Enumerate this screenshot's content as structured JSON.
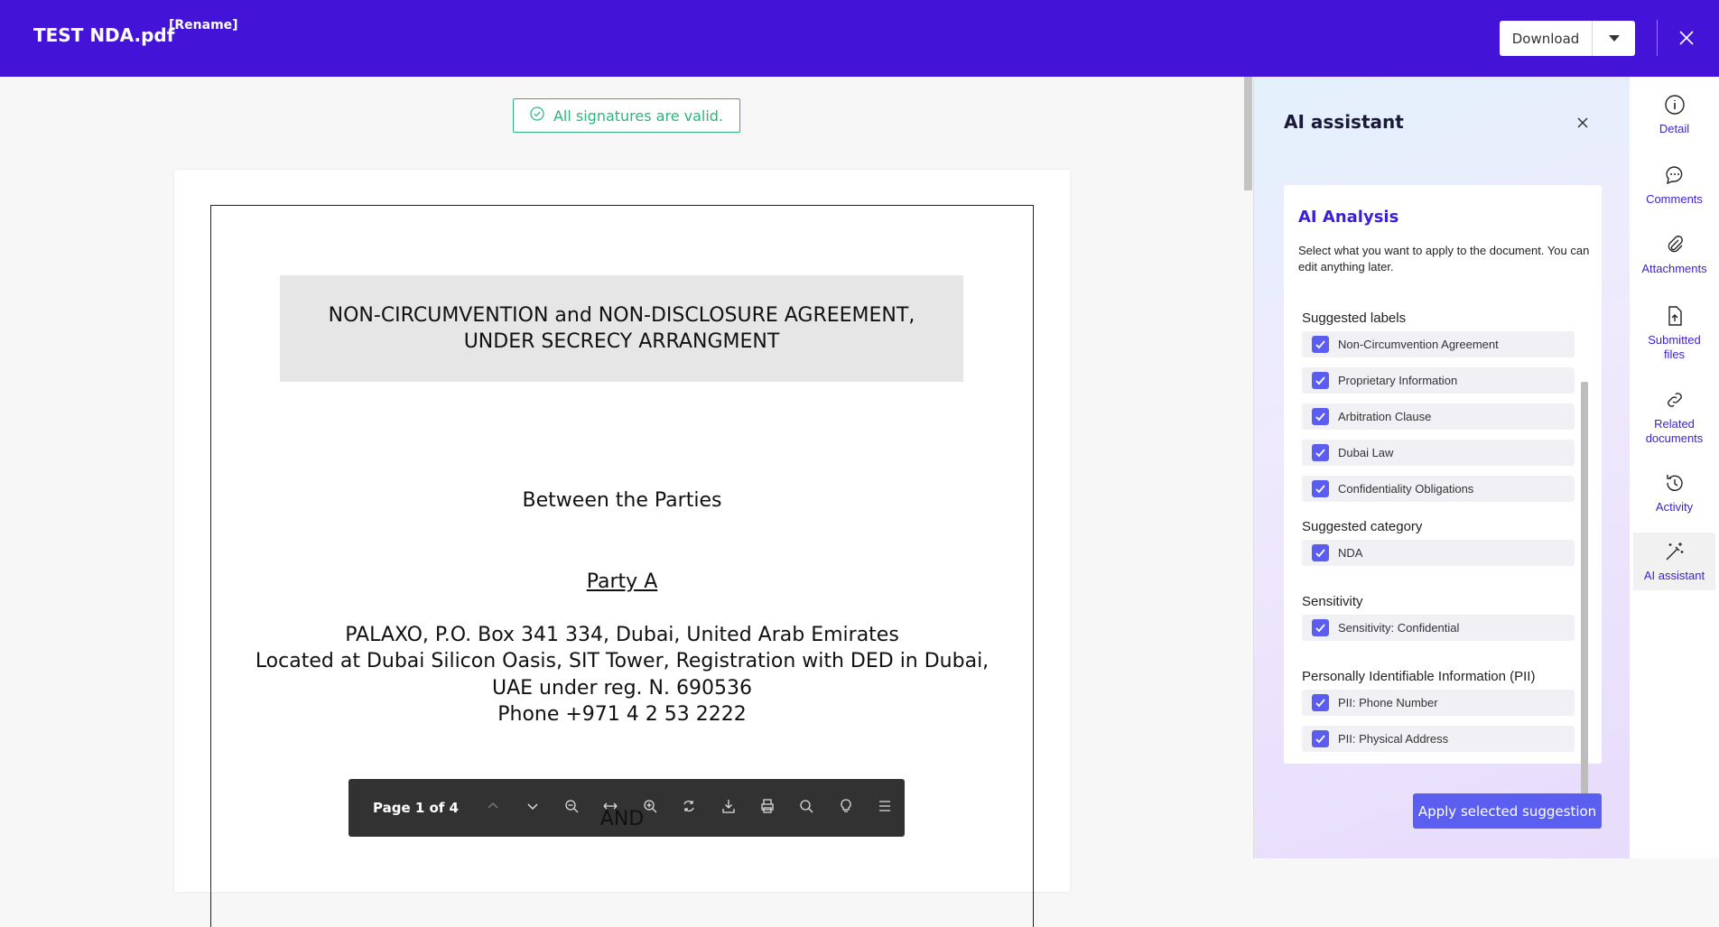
{
  "header": {
    "file_title": "TEST NDA.pdf",
    "rename_label": "[Rename]",
    "download_label": "Download",
    "brand_color": "#4314d8"
  },
  "viewer": {
    "signature_status": "All signatures are valid.",
    "document": {
      "heading_line1": "NON-CIRCUMVENTION and NON-DISCLOSURE AGREEMENT,",
      "heading_line2": "UNDER SECRECY ARRANGMENT",
      "between": "Between the Parties",
      "party_a": "Party A",
      "address1": "PALAXO, P.O. Box 341 334, Dubai, United Arab Emirates",
      "address2": "Located at Dubai Silicon Oasis, SIT Tower, Registration with DED in Dubai,",
      "address3": "UAE under reg. N. 690536",
      "phone": "Phone  +971 4 2 53 2222",
      "and": "AND"
    },
    "toolbar": {
      "page_info": "Page 1 of 4",
      "icons": [
        "chevron-up-icon",
        "chevron-down-icon",
        "zoom-out-icon",
        "fit-width-icon",
        "zoom-in-icon",
        "rotate-icon",
        "download-icon",
        "print-icon",
        "search-icon",
        "lightbulb-icon",
        "menu-icon"
      ]
    }
  },
  "ai_panel": {
    "title": "AI assistant",
    "card_title": "AI Analysis",
    "description": "Select what you want to apply to the document. You can edit anything later.",
    "sections": [
      {
        "heading": "Suggested labels",
        "items": [
          "Non-Circumvention Agreement",
          "Proprietary Information",
          "Arbitration Clause",
          "Dubai Law",
          "Confidentiality Obligations"
        ]
      },
      {
        "heading": "Suggested category",
        "items": [
          "NDA"
        ]
      },
      {
        "heading": "Sensitivity",
        "items": [
          "Sensitivity: Confidential"
        ]
      },
      {
        "heading": "Personally Identifiable Information (PII)",
        "items": [
          "PII: Phone Number",
          "PII: Physical Address"
        ]
      }
    ],
    "apply_label": "Apply selected suggestion",
    "accent_color": "#5a5ff0"
  },
  "rail": {
    "items": [
      {
        "label": "Detail",
        "icon": "info-icon"
      },
      {
        "label": "Comments",
        "icon": "comment-icon"
      },
      {
        "label": "Attachments",
        "icon": "paperclip-icon"
      },
      {
        "label": "Submitted files",
        "icon": "file-upload-icon"
      },
      {
        "label": "Related documents",
        "icon": "link-icon"
      },
      {
        "label": "Activity",
        "icon": "history-icon"
      },
      {
        "label": "AI assistant",
        "icon": "magic-wand-icon"
      }
    ]
  }
}
